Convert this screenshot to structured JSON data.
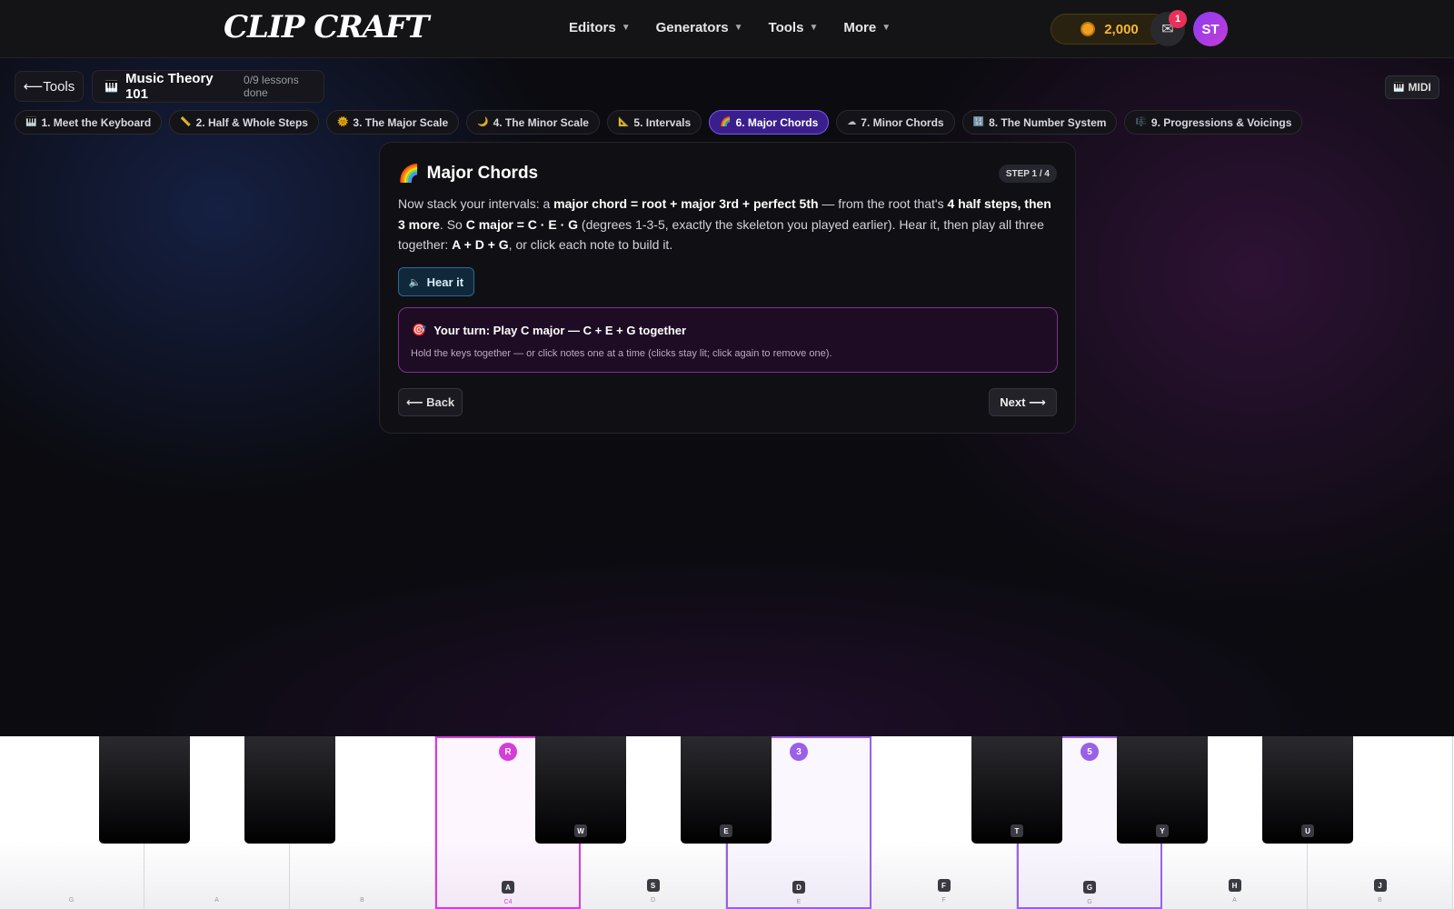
{
  "header": {
    "logo": "CLIP CRAFT",
    "nav": [
      "Editors",
      "Generators",
      "Tools",
      "More"
    ],
    "coins": "2,000",
    "mail_badge": "1",
    "avatar": "ST"
  },
  "toolbar": {
    "back_label": "Tools",
    "course_title": "Music Theory 101",
    "course_progress": "0/9 lessons done",
    "midi_label": "MIDI"
  },
  "lessons": [
    {
      "label": "1. Meet the Keyboard",
      "icon": "keyboard-icon"
    },
    {
      "label": "2. Half & Whole Steps",
      "icon": "ruler-icon"
    },
    {
      "label": "3. The Major Scale",
      "icon": "sun-icon"
    },
    {
      "label": "4. The Minor Scale",
      "icon": "moon-icon"
    },
    {
      "label": "5. Intervals",
      "icon": "triangle-ruler-icon"
    },
    {
      "label": "6. Major Chords",
      "icon": "rainbow-icon",
      "active": true
    },
    {
      "label": "7. Minor Chords",
      "icon": "cloud-icon"
    },
    {
      "label": "8. The Number System",
      "icon": "numbers-icon"
    },
    {
      "label": "9. Progressions & Voicings",
      "icon": "music-notes-icon"
    }
  ],
  "card": {
    "title": "Major Chords",
    "step": "STEP 1 / 4",
    "paragraph": {
      "p1": "Now stack your intervals: a ",
      "b1": "major chord = root + major 3rd + perfect 5th",
      "p2": " — from the root that's ",
      "b2": "4 half steps, then 3 more",
      "p3": ". So ",
      "b3": "C major = C · E · G",
      "p4": " (degrees 1-3-5, exactly the skeleton you played earlier). Hear it, then play all three together: ",
      "b4": "A + D + G",
      "p5": ", or click each note to build it."
    },
    "hear_label": "Hear it",
    "task_title": "Your turn: Play C major — C + E + G together",
    "task_hint": "Hold the keys together — or click notes one at a time (clicks stay lit; click again to remove one).",
    "back_label": "Back",
    "next_label": "Next"
  },
  "piano": {
    "white_keys": [
      {
        "note": "G",
        "key": ""
      },
      {
        "note": "A",
        "key": ""
      },
      {
        "note": "B",
        "key": ""
      },
      {
        "note": "C4",
        "key": "A",
        "highlight": "pink",
        "degree": "R"
      },
      {
        "note": "D",
        "key": "S"
      },
      {
        "note": "E",
        "key": "D",
        "highlight": "purple",
        "degree": "3"
      },
      {
        "note": "F",
        "key": "F"
      },
      {
        "note": "G",
        "key": "G",
        "highlight": "purple",
        "degree": "5"
      },
      {
        "note": "A",
        "key": "H"
      },
      {
        "note": "B",
        "key": "J"
      }
    ],
    "black_keys": [
      {
        "key": ""
      },
      {
        "key": ""
      },
      {
        "key": "W"
      },
      {
        "key": "E"
      },
      {
        "key": "T"
      },
      {
        "key": "Y"
      },
      {
        "key": "U"
      }
    ],
    "colors": {
      "root": "#d63ed8",
      "degree": "#9a60e8"
    }
  }
}
